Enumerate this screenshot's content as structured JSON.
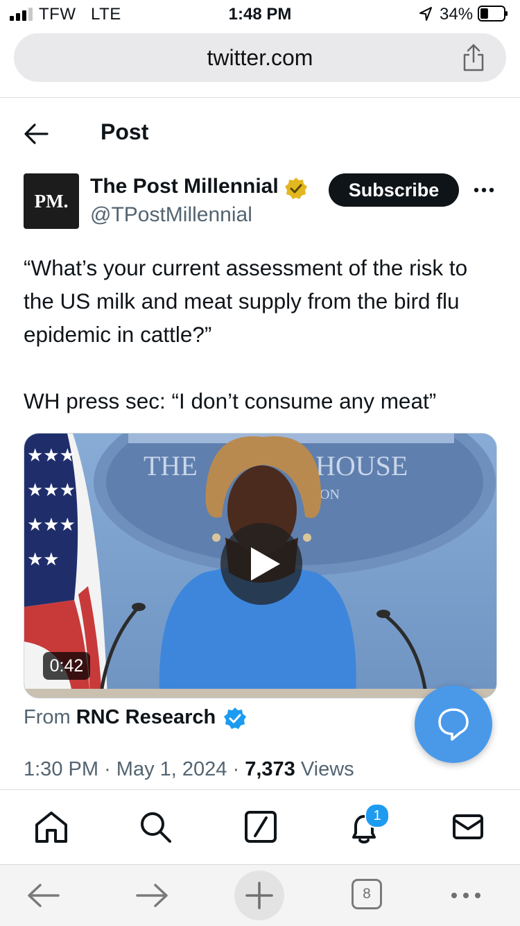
{
  "status_bar": {
    "carrier": "TFW",
    "network": "LTE",
    "time": "1:48 PM",
    "battery_percent": "34%",
    "battery_level": 0.34,
    "signal_bars": 3
  },
  "browser": {
    "url": "twitter.com",
    "share_icon": "share-icon",
    "toolbar": {
      "back_icon": "arrow-left-icon",
      "forward_icon": "arrow-right-icon",
      "new_tab_icon": "plus-icon",
      "tab_count": "8",
      "more_icon": "ellipsis-icon"
    }
  },
  "header": {
    "title": "Post",
    "back_icon": "arrow-left-icon"
  },
  "post": {
    "author": {
      "avatar_text": "PM.",
      "name": "The Post Millennial",
      "handle": "@TPostMillennial",
      "verified": "gold"
    },
    "subscribe_label": "Subscribe",
    "more_icon": "ellipsis-icon",
    "text": "“What’s your current assessment of the risk to the US milk and meat supply from the bird flu epidemic in cattle?”\n\nWH press sec: “I don’t consume any meat”",
    "video": {
      "duration": "0:42",
      "overlay_letters_left": "THE",
      "overlay_letters_right": "HOUSE",
      "overlay_letters_sub": "ON"
    },
    "attribution": {
      "prefix": "From",
      "source": "RNC Research",
      "verified": "blue"
    },
    "time": "1:30 PM",
    "date": "May 1, 2024",
    "views_count": "7,373",
    "views_label": "Views",
    "separator": "·"
  },
  "bottom_nav": {
    "items": [
      {
        "name": "home",
        "icon": "home-icon"
      },
      {
        "name": "search",
        "icon": "search-icon"
      },
      {
        "name": "grok",
        "icon": "slash-square-icon"
      },
      {
        "name": "notifications",
        "icon": "bell-icon",
        "badge": "1"
      },
      {
        "name": "messages",
        "icon": "envelope-icon"
      }
    ]
  },
  "colors": {
    "accent": "#1d9bf0",
    "fab": "#4a99e9",
    "gold_badge": "#e2b720",
    "text": "#0f1419",
    "secondary_text": "#536471"
  }
}
